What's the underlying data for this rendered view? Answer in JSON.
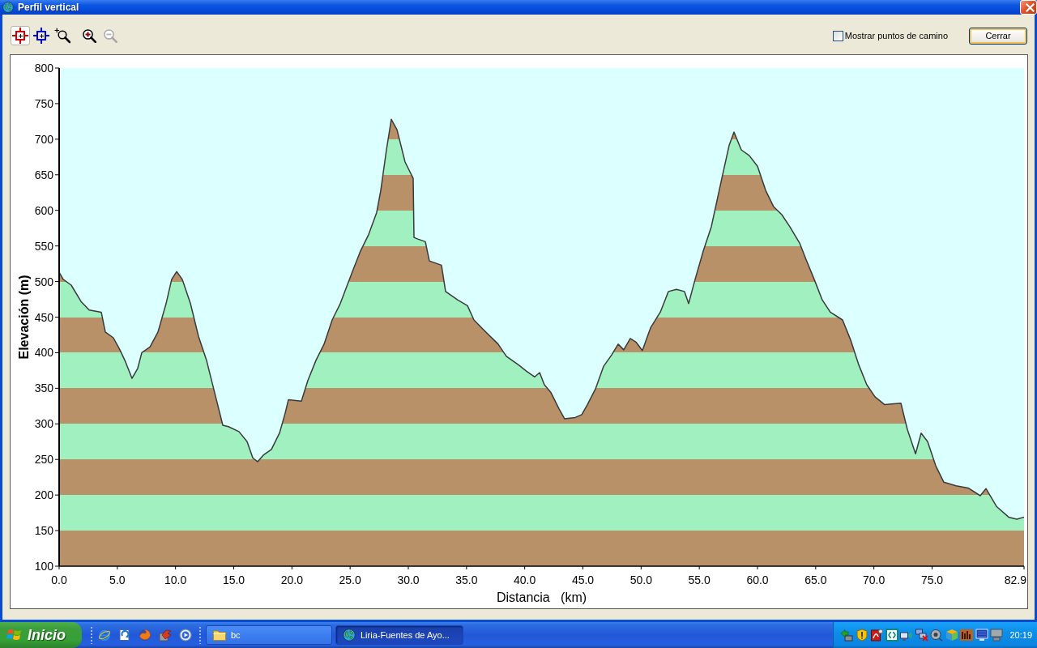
{
  "window": {
    "title": "Perfil vertical"
  },
  "toolbar": {
    "groups": [
      {
        "tools": [
          {
            "kind": "crosshair",
            "color": "#cc0000",
            "selected": true,
            "disabled": false
          },
          {
            "kind": "crosshair",
            "color": "#0000cc",
            "selected": false,
            "disabled": false
          },
          {
            "kind": "zoom-box",
            "selected": false,
            "disabled": false
          }
        ]
      },
      {
        "tools": [
          {
            "kind": "zoom-in",
            "selected": false,
            "disabled": false
          },
          {
            "kind": "zoom-out",
            "selected": false,
            "disabled": true
          }
        ]
      }
    ],
    "waypoints_checkbox": {
      "label": "Mostrar puntos de camino",
      "checked": false
    },
    "close_button": {
      "label": "Cerrar"
    }
  },
  "profile_panel": {
    "chart_data": {
      "type": "area",
      "xlabel": "Distancia   (km)",
      "ylabel": "Elevación (m)",
      "xlim": [
        0,
        82.9
      ],
      "ylim": [
        100,
        800
      ],
      "xticks": [
        {
          "value": 0,
          "label": "0.0"
        },
        {
          "value": 5,
          "label": "5.0"
        },
        {
          "value": 10,
          "label": "10.0"
        },
        {
          "value": 15,
          "label": "15.0"
        },
        {
          "value": 20,
          "label": "20.0"
        },
        {
          "value": 25,
          "label": "25.0"
        },
        {
          "value": 30,
          "label": "30.0"
        },
        {
          "value": 35,
          "label": "35.0"
        },
        {
          "value": 40,
          "label": "40.0"
        },
        {
          "value": 45,
          "label": "45.0"
        },
        {
          "value": 50,
          "label": "50.0"
        },
        {
          "value": 55,
          "label": "55.0"
        },
        {
          "value": 60,
          "label": "60.0"
        },
        {
          "value": 65,
          "label": "65.0"
        },
        {
          "value": 70,
          "label": "70.0"
        },
        {
          "value": 75,
          "label": "75.0"
        },
        {
          "value": 82.9,
          "label": "82.9"
        }
      ],
      "yticks": [
        100,
        150,
        200,
        250,
        300,
        350,
        400,
        450,
        500,
        550,
        600,
        650,
        700,
        750,
        800
      ],
      "x": [
        0,
        0.35,
        1.04,
        1.88,
        2.58,
        3.62,
        3.97,
        4.66,
        5.22,
        5.71,
        6.26,
        6.75,
        7.1,
        7.8,
        8.49,
        9.19,
        9.67,
        10.09,
        10.58,
        11.28,
        11.97,
        12.67,
        13.36,
        14.06,
        14.55,
        15.45,
        16.15,
        16.64,
        17.05,
        17.54,
        18.24,
        18.93,
        19.42,
        19.7,
        20.81,
        21.37,
        22.06,
        22.76,
        23.46,
        24.15,
        25.2,
        25.89,
        26.59,
        27.28,
        27.63,
        28.12,
        28.54,
        29.03,
        29.72,
        30.42,
        30.49,
        30.77,
        31.46,
        31.81,
        32.85,
        33.2,
        34.25,
        35.08,
        35.64,
        36.54,
        37.72,
        38.42,
        39.46,
        40.16,
        40.86,
        41.28,
        41.69,
        42.25,
        42.95,
        43.43,
        44.34,
        44.9,
        45.38,
        46.08,
        46.78,
        47.47,
        48.03,
        48.51,
        49.07,
        49.56,
        50.11,
        50.81,
        51.65,
        52.34,
        53.04,
        53.73,
        54.08,
        54.64,
        55.34,
        56.03,
        56.87,
        57.56,
        57.98,
        58.61,
        59.3,
        60,
        60.7,
        61.39,
        62.09,
        62.78,
        63.62,
        64.17,
        64.87,
        65.57,
        66.26,
        67.31,
        68,
        68.7,
        69.39,
        70.09,
        70.93,
        72.32,
        72.88,
        73.58,
        74.06,
        74.62,
        75.31,
        76.01,
        77.06,
        78.1,
        79.14,
        79.63,
        80.53,
        81.58,
        82.28,
        82.9
      ],
      "values": [
        513,
        503,
        495,
        472,
        460,
        457,
        429,
        421,
        404,
        387,
        364,
        378,
        400,
        408,
        429,
        469,
        503,
        514,
        503,
        469,
        423,
        389,
        344,
        298,
        296,
        289,
        275,
        252,
        247,
        256,
        264,
        287,
        315,
        334,
        332,
        361,
        389,
        412,
        446,
        469,
        514,
        543,
        566,
        597,
        628,
        685,
        728,
        713,
        668,
        645,
        562,
        560,
        556,
        529,
        523,
        486,
        474,
        466,
        446,
        431,
        412,
        395,
        383,
        374,
        366,
        372,
        355,
        344,
        321,
        307,
        309,
        313,
        327,
        349,
        381,
        397,
        412,
        404,
        420,
        415,
        403,
        435,
        457,
        486,
        489,
        486,
        469,
        503,
        543,
        577,
        640,
        691,
        710,
        685,
        677,
        662,
        628,
        605,
        594,
        577,
        554,
        531,
        503,
        474,
        457,
        446,
        418,
        383,
        355,
        338,
        327,
        329,
        292,
        258,
        287,
        275,
        241,
        218,
        213,
        210,
        199,
        209,
        184,
        169,
        166,
        169
      ]
    }
  },
  "taskbar": {
    "start_button": {
      "label": "Inicio"
    },
    "tasks": [
      {
        "kind": "folder",
        "label": "bc",
        "selected": false
      },
      {
        "kind": "globe",
        "label": "Liria-Fuentes de Ayo...",
        "selected": true
      }
    ],
    "clock": "20:19"
  }
}
